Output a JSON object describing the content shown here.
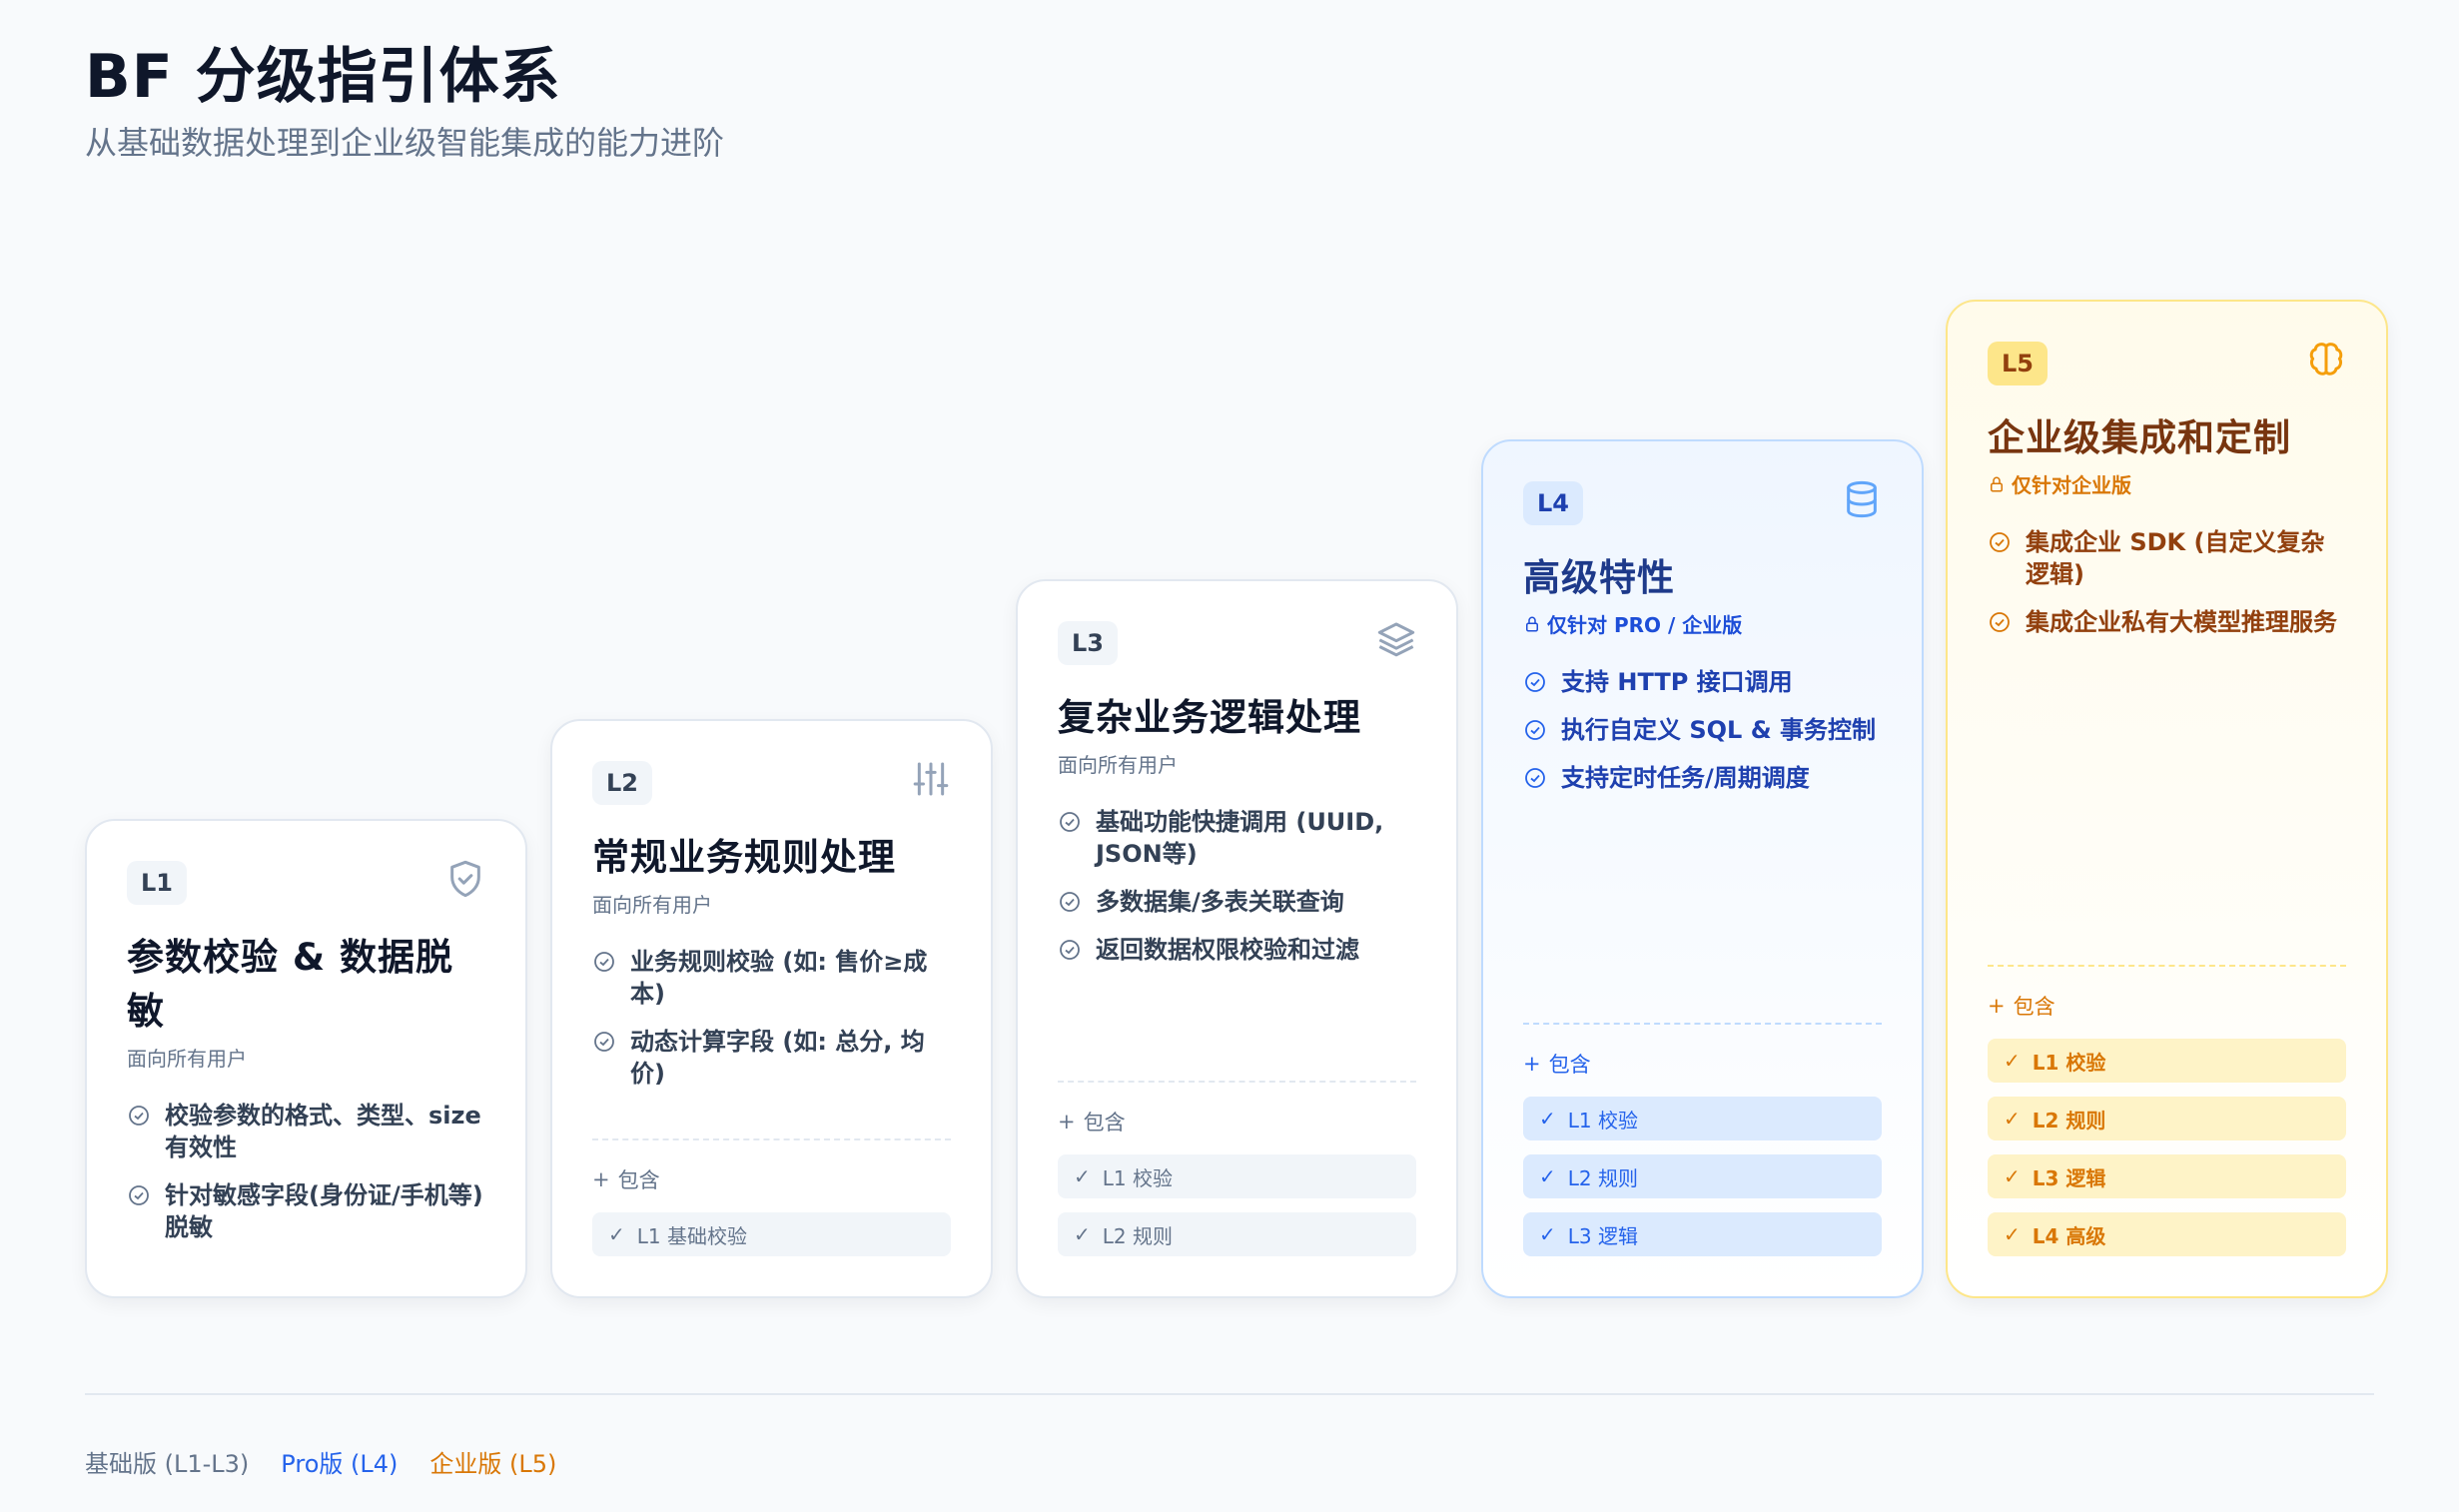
{
  "header": {
    "title": "BF 分级指引体系",
    "subtitle": "从基础数据处理到企业级智能集成的能力进阶"
  },
  "cards": [
    {
      "level": "L1",
      "icon": "shield-icon",
      "title": "参数校验 & 数据脱敏",
      "audience": "面向所有用户",
      "features": [
        "校验参数的格式、类型、size有效性",
        "针对敏感字段(身份证/手机等)脱敏"
      ],
      "includes_label": "",
      "includes": []
    },
    {
      "level": "L2",
      "icon": "sliders-icon",
      "title": "常规业务规则处理",
      "audience": "面向所有用户",
      "features": [
        "业务规则校验 (如: 售价≥成本)",
        "动态计算字段 (如: 总分, 均价)"
      ],
      "includes_label": "包含",
      "includes": [
        "L1 基础校验"
      ]
    },
    {
      "level": "L3",
      "icon": "layers-icon",
      "title": "复杂业务逻辑处理",
      "audience": "面向所有用户",
      "features": [
        "基础功能快捷调用 (UUID, JSON等)",
        "多数据集/多表关联查询",
        "返回数据权限校验和过滤"
      ],
      "includes_label": "包含",
      "includes": [
        "L1 校验",
        "L2 规则"
      ]
    },
    {
      "level": "L4",
      "icon": "database-icon",
      "title": "高级特性",
      "audience": "仅针对 PRO / 企业版",
      "features": [
        "支持 HTTP 接口调用",
        "执行自定义 SQL & 事务控制",
        "支持定时任务/周期调度"
      ],
      "includes_label": "包含",
      "includes": [
        "L1 校验",
        "L2 规则",
        "L3 逻辑"
      ]
    },
    {
      "level": "L5",
      "icon": "brain-icon",
      "title": "企业级集成和定制",
      "audience": "仅针对企业版",
      "features": [
        "集成企业 SDK (自定义复杂逻辑)",
        "集成企业私有大模型推理服务"
      ],
      "includes_label": "包含",
      "includes": [
        "L1 校验",
        "L2 规则",
        "L3 逻辑",
        "L4 高级"
      ]
    }
  ],
  "legend": {
    "basic": "基础版 (L1-L3)",
    "pro": "Pro版 (L4)",
    "enterprise": "企业版 (L5)"
  },
  "colors": {
    "basic_text": "#64748b",
    "pro_accent": "#2563eb",
    "enterprise_accent": "#d97706"
  }
}
